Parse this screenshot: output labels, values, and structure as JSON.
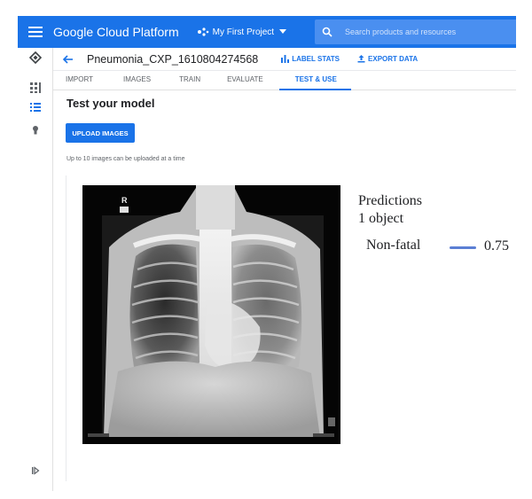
{
  "topbar": {
    "brand": "Google Cloud Platform",
    "project": "My First Project",
    "search_placeholder": "Search products and resources",
    "color": "#1a73e8"
  },
  "rail": {
    "icons": [
      "automl-logo-icon",
      "grid-icon",
      "list-icon",
      "lightbulb-icon",
      "expand-rail-icon"
    ]
  },
  "header": {
    "dataset_name": "Pneumonia_CXP_1610804274568",
    "label_stats": "LABEL STATS",
    "export_data": "EXPORT DATA"
  },
  "tabs": [
    {
      "label": "IMPORT",
      "active": false
    },
    {
      "label": "IMAGES",
      "active": false
    },
    {
      "label": "TRAIN",
      "active": false
    },
    {
      "label": "EVALUATE",
      "active": false
    },
    {
      "label": "TEST & USE",
      "active": true
    }
  ],
  "main": {
    "title": "Test your model",
    "upload_button": "UPLOAD IMAGES",
    "hint": "Up to 10 images can be uploaded at a time",
    "xray_marker": "R"
  },
  "predictions": {
    "title": "Predictions",
    "count": "1 object",
    "items": [
      {
        "label": "Non-fatal",
        "score": "0.75",
        "color": "#5b7fd4"
      }
    ]
  }
}
